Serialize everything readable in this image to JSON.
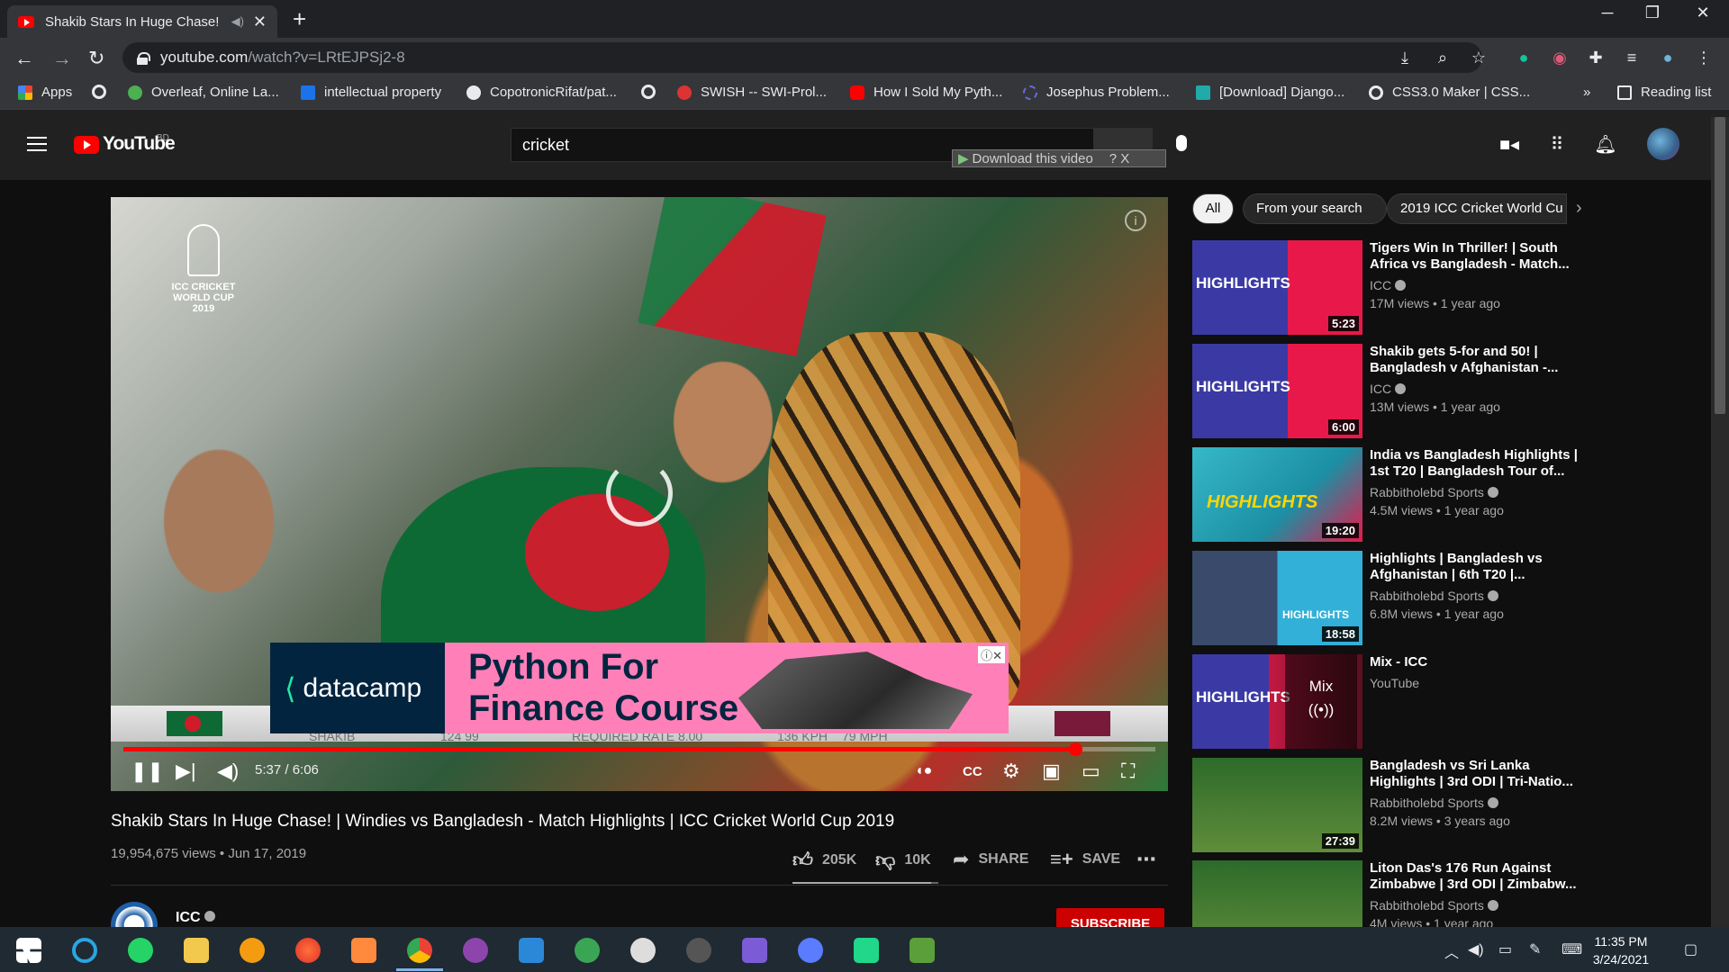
{
  "browser": {
    "tab_title": "Shakib Stars In Huge Chase! |",
    "url_host": "youtube.com",
    "url_path": "/watch?v=LRtEJPSj2-8",
    "bookmarks": [
      {
        "label": "Apps",
        "color": "#ea4335"
      },
      {
        "label": "",
        "color": "#e8eaed"
      },
      {
        "label": "Overleaf, Online La...",
        "color": "#4caf50"
      },
      {
        "label": "intellectual property",
        "color": "#1a73e8"
      },
      {
        "label": "CopotronicRifat/pat...",
        "color": "#e8eaed"
      },
      {
        "label": "",
        "color": "#e8eaed"
      },
      {
        "label": "SWISH -- SWI-Prol...",
        "color": "#d33"
      },
      {
        "label": "How I Sold My Pyth...",
        "color": "#ff0000"
      },
      {
        "label": "Josephus Problem...",
        "color": "#6a6ad9"
      },
      {
        "label": "[Download] Django...",
        "color": "#2aa"
      },
      {
        "label": "CSS3.0 Maker | CSS...",
        "color": "#e8eaed"
      }
    ],
    "overflow": "»",
    "reading_list": "Reading list"
  },
  "youtube": {
    "logo_text": "YouTube",
    "country_code": "BD",
    "search_value": "cricket",
    "download_bar": "Download this video",
    "download_bar_extras": "? X"
  },
  "player": {
    "time": "5:37 / 6:06",
    "progress_fraction": 0.922,
    "wc_logo": "ICC CRICKET WORLD CUP 2019",
    "ad_brand": "datacamp",
    "ad_headline_1": "Python For",
    "ad_headline_2": "Finance Course",
    "lowerthird": [
      "SHAKIB",
      "124 99",
      "REQUIRED RATE 8.00",
      "136 KPH",
      "79 MPH"
    ]
  },
  "video": {
    "title": "Shakib Stars In Huge Chase! | Windies vs Bangladesh - Match Highlights | ICC Cricket World Cup 2019",
    "meta": "19,954,675 views • Jun 17, 2019",
    "likes": "205K",
    "dislikes": "10K",
    "like_fraction": 0.953,
    "share": "SHARE",
    "save": "SAVE",
    "channel": "ICC",
    "subscribe": "SUBSCRIBE"
  },
  "chips": [
    "All",
    "From your search",
    "2019 ICC Cricket World Cu"
  ],
  "recommendations": [
    {
      "title": "Tigers Win In Thriller! | South Africa vs Bangladesh - Match...",
      "channel": "ICC",
      "views": "17M views • 1 year ago",
      "duration": "5:23",
      "thumb_label": "HIGHLIGHTS",
      "style": "t-hl"
    },
    {
      "title": "Shakib gets 5-for and 50! | Bangladesh v Afghanistan -...",
      "channel": "ICC",
      "views": "13M views • 1 year ago",
      "duration": "6:00",
      "thumb_label": "HIGHLIGHTS",
      "style": "t-hl"
    },
    {
      "title": "India vs Bangladesh Highlights | 1st T20 | Bangladesh Tour of...",
      "channel": "Rabbitholebd Sports",
      "views": "4.5M views • 1 year ago",
      "duration": "19:20",
      "thumb_label": "HIGHLIGHTS",
      "style": "t-ind"
    },
    {
      "title": "Highlights | Bangladesh vs Afghanistan | 6th T20 |...",
      "channel": "Rabbitholebd Sports",
      "views": "6.8M views • 1 year ago",
      "duration": "18:58",
      "thumb_label": "HIGHLIGHTS",
      "style": "t-afg"
    },
    {
      "title": "Mix - ICC",
      "channel": "YouTube",
      "views": "",
      "duration": "",
      "thumb_label": "HIGHLIGHTS",
      "mix_label": "Mix",
      "style": "t-mix"
    },
    {
      "title": "Bangladesh vs Sri Lanka Highlights | 3rd ODI | Tri-Natio...",
      "channel": "Rabbitholebd Sports",
      "views": "8.2M views • 3 years ago",
      "duration": "27:39",
      "thumb_label": "",
      "style": "t-field"
    },
    {
      "title": "Liton Das's 176 Run Against Zimbabwe | 3rd ODI | Zimbabw...",
      "channel": "Rabbitholebd Sports",
      "views": "4M views • 1 year ago",
      "duration": "",
      "thumb_label": "",
      "style": "t-field"
    }
  ],
  "taskbar": {
    "time": "11:35 PM",
    "date": "3/24/2021"
  }
}
